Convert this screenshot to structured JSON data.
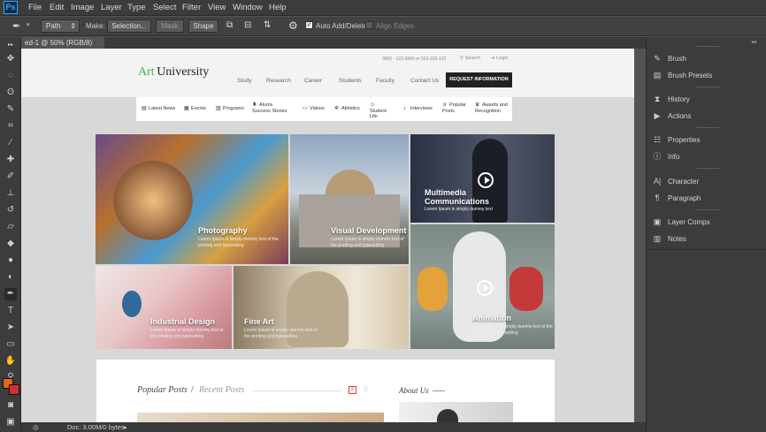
{
  "app": {
    "logo": "Ps"
  },
  "menu": [
    "File",
    "Edit",
    "Image",
    "Layer",
    "Type",
    "Select",
    "Filter",
    "View",
    "Window",
    "Help"
  ],
  "options": {
    "path_mode": "Path",
    "make_label": "Make:",
    "selection_btn": "Selection...",
    "mask_btn": "Mask",
    "shape_btn": "Shape",
    "auto_add_delete": "Auto Add/Delete",
    "align_edges": "Align Edges"
  },
  "document": {
    "tab_label": "ed-1 @ 50% (RGB/8) *",
    "doc_size": "Doc: 3.00M/0 bytes"
  },
  "panels": {
    "group1": [
      "Brush",
      "Brush Presets"
    ],
    "group2": [
      "History",
      "Actions"
    ],
    "group3": [
      "Properties",
      "Info"
    ],
    "group4": [
      "Character",
      "Paragraph"
    ],
    "group5": [
      "Layer Comps",
      "Notes"
    ]
  },
  "site": {
    "logo_art": "Art",
    "logo_university": "University",
    "top_info": "3800 - 123-3800  or  323-100-123",
    "search": "Search",
    "login": "Login",
    "nav": [
      "Study",
      "Research",
      "Career",
      "Students",
      "Faculty",
      "Contact Us"
    ],
    "request_btn": "REQUEST INFORMATION",
    "categories": [
      "Latest News",
      "Events",
      "Programs",
      "Alums Success Stories",
      "Videos",
      "Athletics",
      "Student Life",
      "Interviews",
      "Popular Posts",
      "Awards and Recognition"
    ],
    "tiles": [
      {
        "title": "Photography",
        "desc": "Lorem Ipsum is simply dummy text of the printing and typesetting"
      },
      {
        "title": "Visual Development",
        "desc": "Lorem Ipsum is simply dummy text of the printing and typesetting"
      },
      {
        "title": "Multimedia Communications",
        "desc": "Lorem Ipsum is simply dummy text"
      },
      {
        "title": "Industrial Design",
        "desc": "Lorem Ipsum is simply dummy text of the printing and typesetting"
      },
      {
        "title": "Fine Art",
        "desc": "Lorem Ipsum is simply dummy text of the printing and typesetting"
      },
      {
        "title": "Animation",
        "desc": "Lorem Ipsum is simply dummy text of the printing and typesetting"
      }
    ],
    "popular_posts": "Popular Posts",
    "slash": "/",
    "recent_posts": "Recent Posts",
    "about_us": "About Us"
  },
  "colors": {
    "accent_green": "#4caf50",
    "fg_color": "#e8621a",
    "bg_color": "#d32f2f"
  }
}
